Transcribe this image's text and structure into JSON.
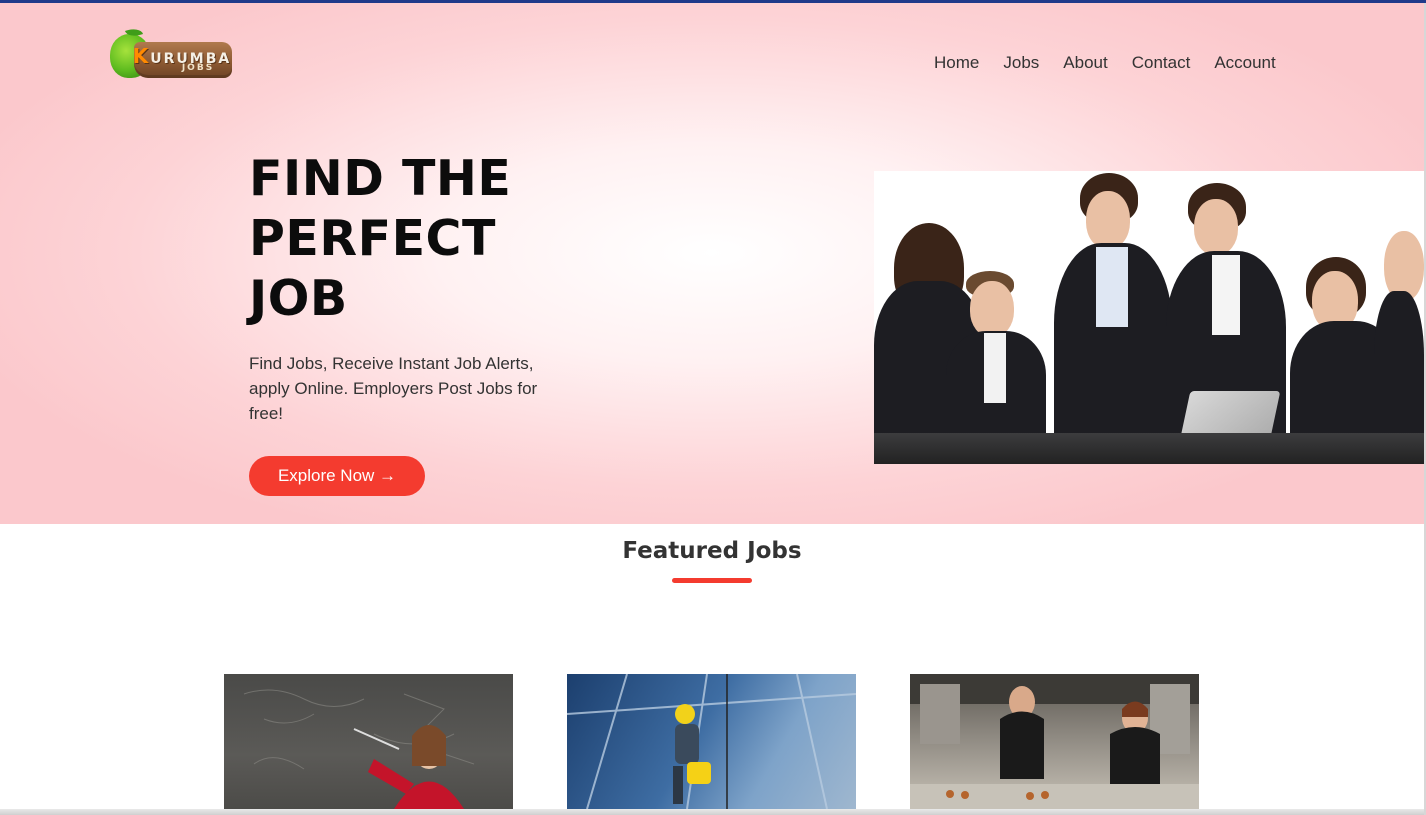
{
  "brand": {
    "logo_text": "KURUMBA",
    "logo_sub": "JOBS"
  },
  "nav": {
    "items": [
      {
        "label": "Home"
      },
      {
        "label": "Jobs"
      },
      {
        "label": "About"
      },
      {
        "label": "Contact"
      },
      {
        "label": "Account"
      }
    ]
  },
  "hero": {
    "headline_lines": [
      "FIND THE",
      "PERFECT",
      "JOB"
    ],
    "subtext": "Find Jobs, Receive Instant Job Alerts, apply Online. Employers Post Jobs for free!",
    "cta_label": "Explore Now →",
    "image_alt": "business-meeting-image"
  },
  "featured": {
    "title": "Featured Jobs",
    "cards": [
      {
        "image": "teacher-at-chalkboard-image"
      },
      {
        "image": "window-cleaner-on-glass-building-image"
      },
      {
        "image": "chefs-in-kitchen-image"
      }
    ]
  },
  "colors": {
    "accent": "#f43b2f",
    "top_border": "#1f3a8a",
    "hero_bg": "#fbc8cc",
    "heading": "#0c0c0c"
  }
}
